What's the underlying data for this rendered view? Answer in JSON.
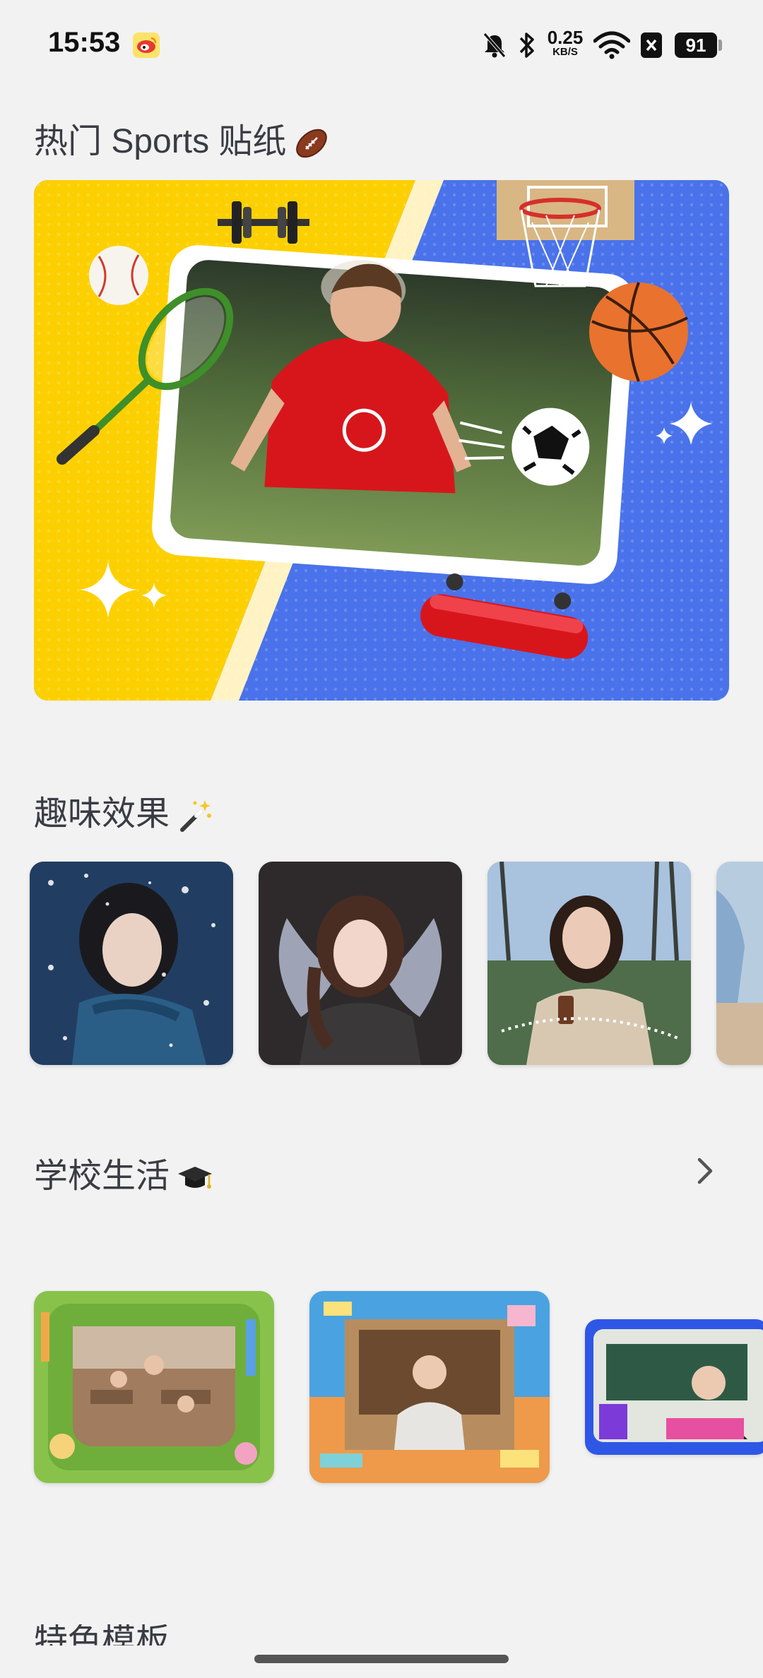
{
  "status_bar": {
    "time": "15:53",
    "net_speed_value": "0.25",
    "net_speed_unit": "KB/S",
    "battery": "91",
    "icons": [
      "weibo-icon",
      "mute-bell-icon",
      "bluetooth-icon",
      "wifi-icon",
      "sim-disabled-icon",
      "battery-icon"
    ]
  },
  "sections": {
    "sports": {
      "title": "热门 Sports 贴纸",
      "emoji": "american-football-icon"
    },
    "fun_effects": {
      "title": "趣味效果",
      "emoji": "magic-wand-icon",
      "items": [
        {
          "name": "snow-effect"
        },
        {
          "name": "angel-wings-effect"
        },
        {
          "name": "sparkle-trail-effect"
        },
        {
          "name": "partial-effect"
        }
      ]
    },
    "school_life": {
      "title": "学校生活",
      "emoji": "graduation-cap-icon",
      "items": [
        {
          "name": "classroom-frame"
        },
        {
          "name": "study-desk-frame"
        },
        {
          "name": "teacher-frame"
        }
      ]
    },
    "next_section": {
      "title": "特色模板"
    }
  },
  "colors": {
    "background": "#f2f2f2",
    "banner_yellow": "#fcd000",
    "banner_blue": "#4a72ea",
    "title_text": "#3b3b44"
  }
}
